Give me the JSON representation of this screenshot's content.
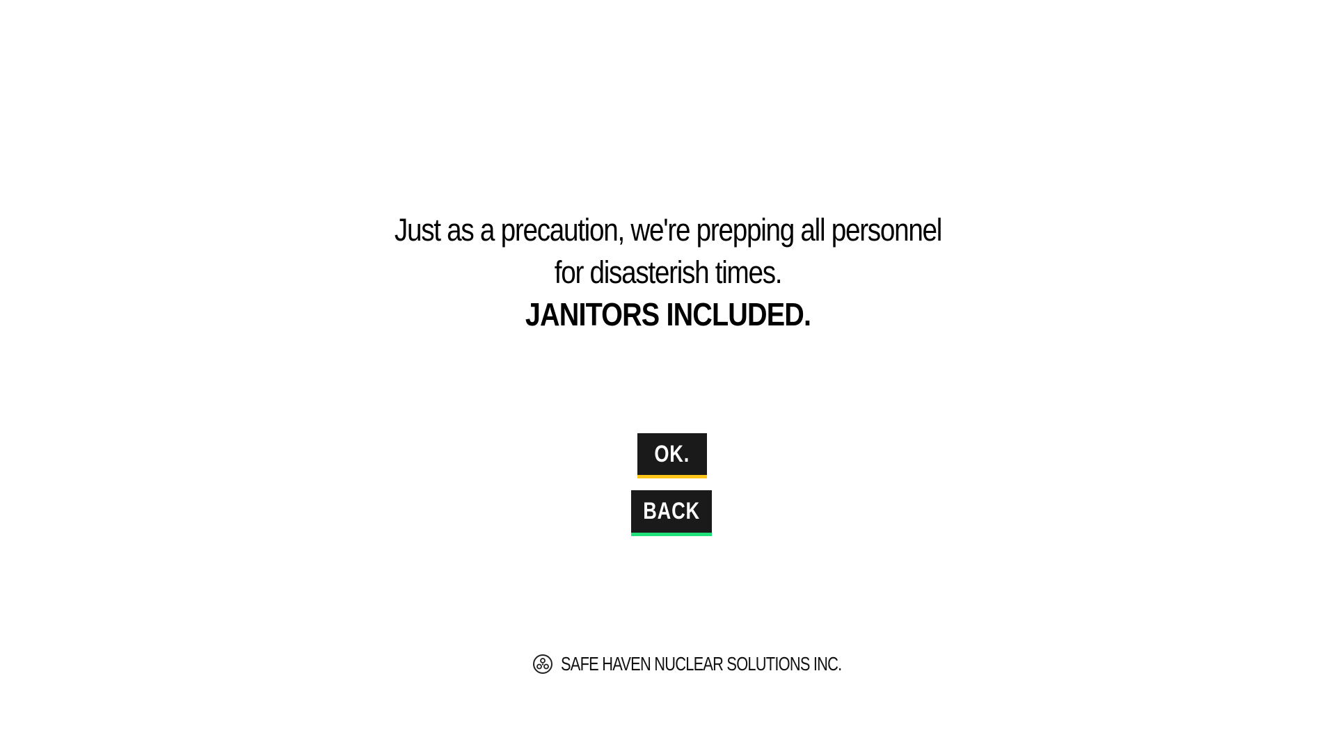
{
  "message": {
    "line1": "Just as a precaution, we're prepping all personnel",
    "line2": "for disasterish times.",
    "emphasis": "JANITORS INCLUDED."
  },
  "buttons": {
    "ok_label": "OK.",
    "back_label": "BACK"
  },
  "footer": {
    "company": "SAFE HAVEN NUCLEAR SOLUTIONS INC.",
    "logo_icon": "radiation-logo-icon"
  },
  "colors": {
    "background": "#ffffff",
    "button_bg": "#1a1a1a",
    "ok_accent": "#ffc61a",
    "back_accent": "#1fe07a"
  }
}
